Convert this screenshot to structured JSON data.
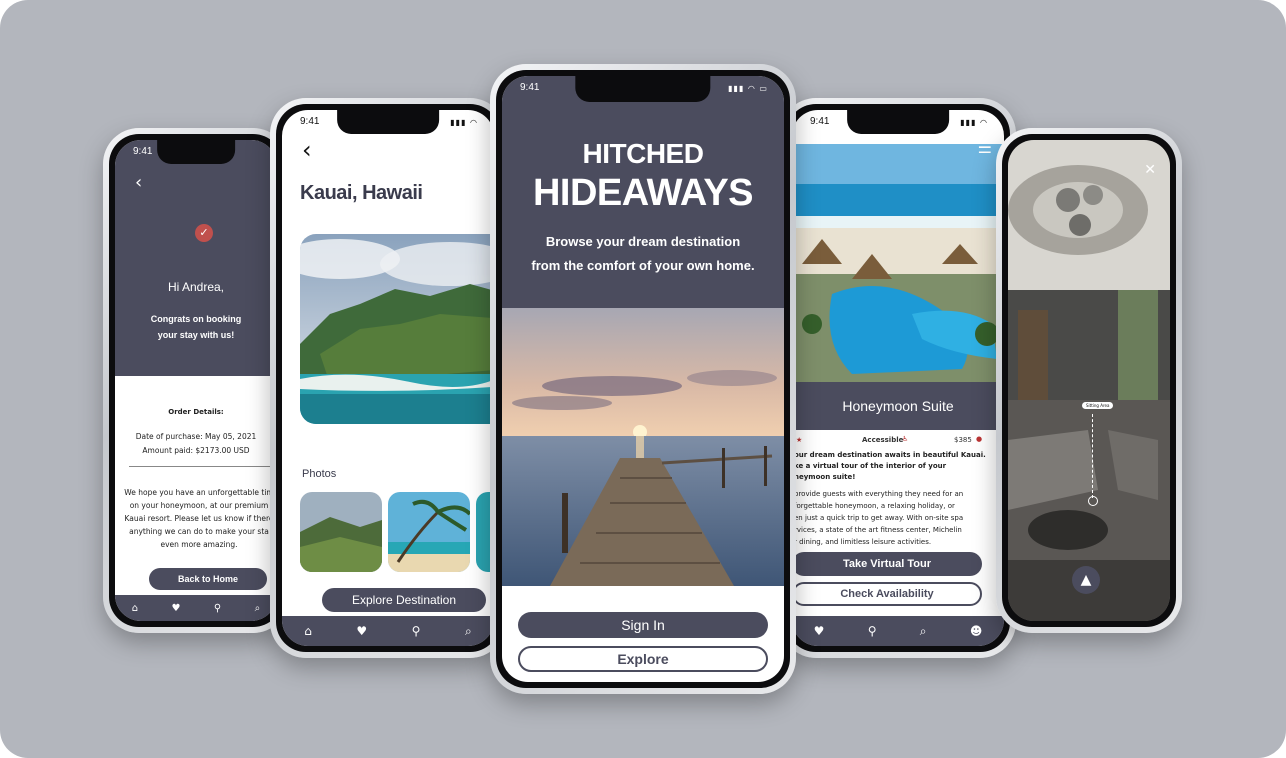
{
  "status_time": "9:41",
  "colors": {
    "navy": "#4b4c5e",
    "frame": "#b3b6bd",
    "check": "#c0504d"
  },
  "confirmation": {
    "greeting": "Hi Andrea,",
    "message_line1": "Congrats on booking",
    "message_line2": "your stay with us!",
    "order_title": "Order Details:",
    "purchase_date": "Date of purchase: May 05, 2021",
    "amount_paid": "Amount paid: $2173.00 USD",
    "note_lines": [
      "We hope you have an unforgettable tim",
      "on your honeymoon, at our premium",
      "Kauai resort. Please let us know if there",
      "anything we can do to make your sta",
      "even more amazing."
    ],
    "back_button": "Back to Home"
  },
  "destination": {
    "title": "Kauai, Hawaii",
    "photos_label": "Photos",
    "explore_button": "Explore Destination"
  },
  "welcome": {
    "title_line1": "HITCHED",
    "title_line2": "HIDEAWAYS",
    "tagline_line1": "Browse your dream destination",
    "tagline_line2": "from the comfort of your own home.",
    "signin_button": "Sign In",
    "explore_button": "Explore"
  },
  "suite": {
    "title": "Honeymoon Suite",
    "accessible": "Accessible",
    "price": "$385",
    "lead_lines": [
      "our dream destination awaits in beautiful Kauai.",
      "ke a virtual tour of the interior of your",
      "neymoon suite!"
    ],
    "body_lines": [
      "provide guests with everything they need for an",
      "forgettable honeymoon, a relaxing holiday, or",
      "en just a quick trip to get away. With on-site spa",
      "rvices, a state of the art fitness center, Michelin",
      "r dining, and limitless leisure activities."
    ],
    "tour_button": "Take Virtual Tour",
    "availability_button": "Check Availability"
  },
  "tour": {
    "hotspot_label": "Sitting Area"
  }
}
